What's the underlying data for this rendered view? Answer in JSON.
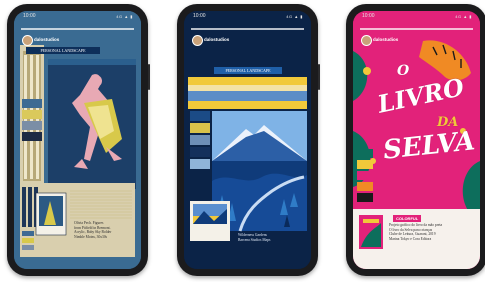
{
  "phones": [
    {
      "status": {
        "time": "10:00",
        "signal": "4G ▲ ▮"
      },
      "username": "dalostudios",
      "banner": "PERSONAL LANDSCAPE",
      "caption": [
        "Olivia Pech. Figures",
        "from Pitfield in Bremont.",
        "Acrylic, Baby Sky Bolder",
        "Nimble Moins, 30x30s"
      ]
    },
    {
      "status": {
        "time": "10:00",
        "signal": "4G ▲ ▮"
      },
      "username": "dalostudios",
      "banner": "PERSONAL LANDSCAPE",
      "caption": [
        "Wilderness Gardens",
        "Barcena Studios Maps"
      ]
    },
    {
      "status": {
        "time": "10:00",
        "signal": "4G ▲ ▮"
      },
      "username": "dalostudios",
      "title": [
        "O",
        "LIVRO",
        "DA",
        "SELVA"
      ],
      "tag": "COLORFUL",
      "caption": [
        "Projeto gráfico do livro da mão preta",
        "O livro da Selva para crianças",
        "Clube de Leitura, Guarani, 2019",
        "Marina Tokyo e Cora Editora"
      ]
    }
  ],
  "colors": {
    "phone_body": "#1b1b1d",
    "p1_background": "#3a6b92",
    "p2_background": "#0b2347",
    "p3_pink": "#e2227a",
    "p3_yellow": "#f1c93a"
  }
}
